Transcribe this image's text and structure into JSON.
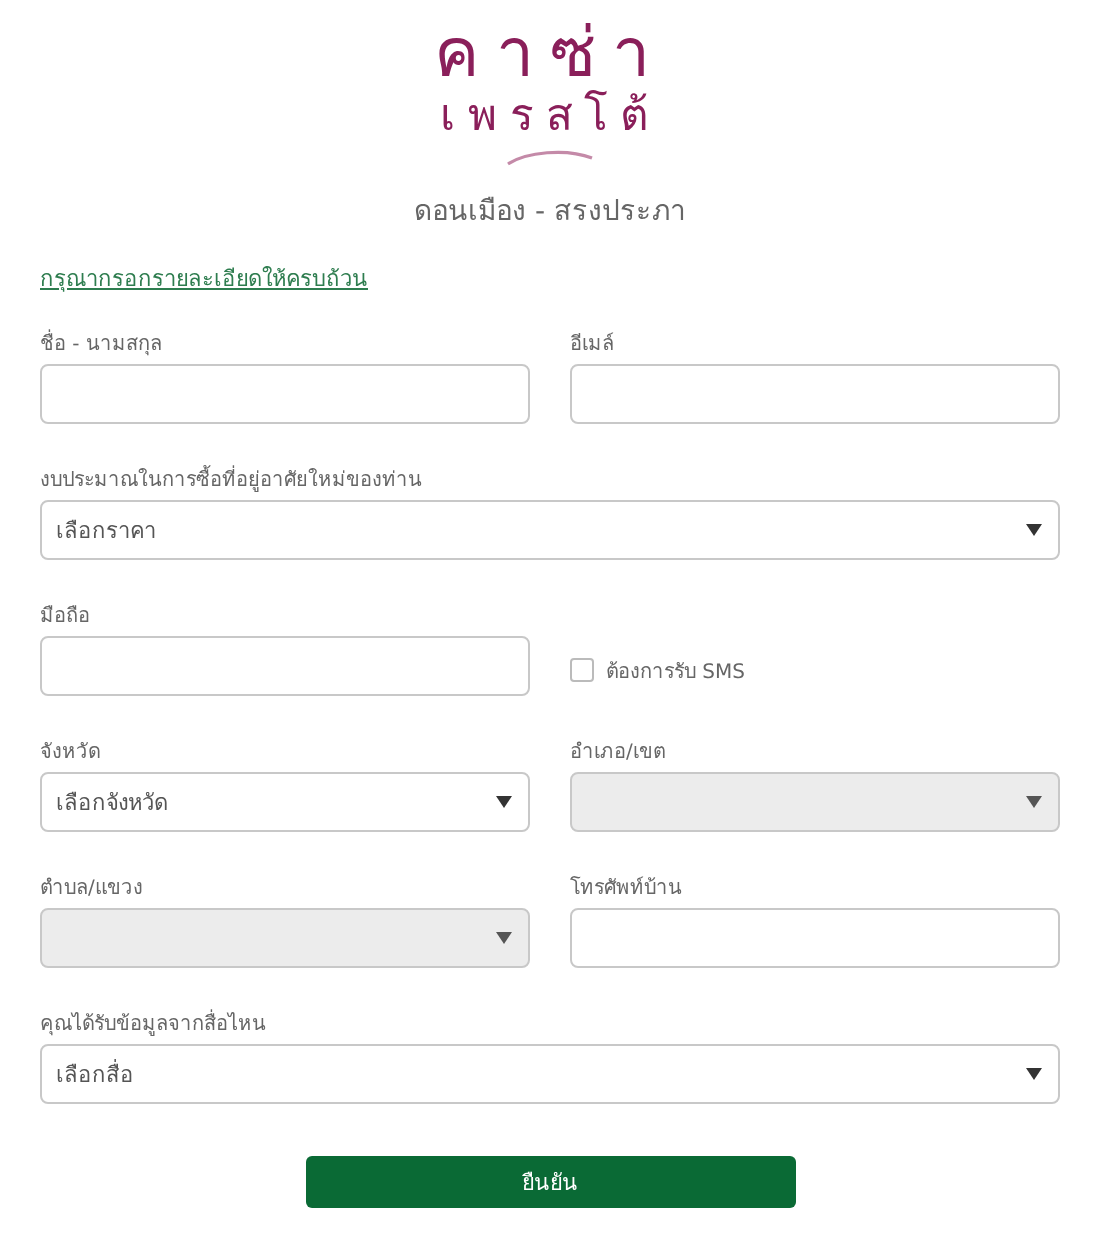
{
  "logo": {
    "line_1": "คาซ่า",
    "line_2": "เพรสโต้"
  },
  "subtitle": "ดอนเมือง - สรงประภา",
  "instruction_link": "กรุณากรอกรายละเอียดให้ครบถ้วน",
  "rows": [
    {
      "fields": [
        {
          "kind": "input",
          "label": "ชื่อ - นามสกุล"
        },
        {
          "kind": "input",
          "label": "อีเมล์"
        }
      ]
    },
    {
      "fields": [
        {
          "kind": "select",
          "label": "งบประมาณในการซื้อที่อยู่อาศัยใหม่ของท่าน",
          "placeholder": "เลือกราคา",
          "disabled": false
        }
      ]
    },
    {
      "fields": [
        {
          "kind": "input",
          "label": "มือถือ"
        },
        {
          "kind": "checkbox",
          "label": "ต้องการรับ SMS",
          "checked": false
        }
      ]
    },
    {
      "fields": [
        {
          "kind": "select",
          "label": "จังหวัด",
          "placeholder": "เลือกจังหวัด",
          "disabled": false
        },
        {
          "kind": "select",
          "label": "อำเภอ/เขต",
          "disabled": true
        }
      ]
    },
    {
      "fields": [
        {
          "kind": "select",
          "label": "ตำบล/แขวง",
          "disabled": true
        },
        {
          "kind": "input",
          "label": "โทรศัพท์บ้าน"
        }
      ]
    },
    {
      "fields": [
        {
          "kind": "select",
          "label": "คุณได้รับข้อมูลจากสื่อไหน",
          "placeholder": "เลือกสื่อ",
          "disabled": false
        }
      ]
    }
  ],
  "submit_button": "ยืนยัน"
}
